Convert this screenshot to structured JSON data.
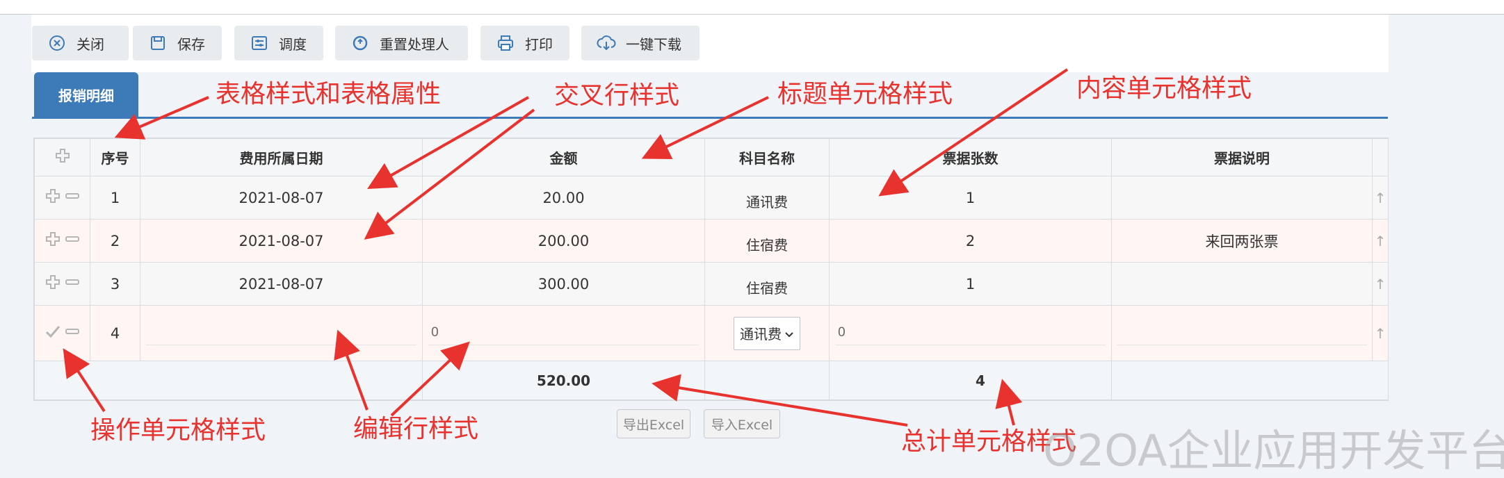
{
  "toolbar": {
    "buttons": [
      {
        "label": "关闭",
        "icon": "close-circle-icon"
      },
      {
        "label": "保存",
        "icon": "save-icon"
      },
      {
        "label": "调度",
        "icon": "dispatch-icon"
      },
      {
        "label": "重置处理人",
        "icon": "reset-icon"
      },
      {
        "label": "打印",
        "icon": "print-icon"
      },
      {
        "label": "一键下载",
        "icon": "cloud-download-icon"
      }
    ]
  },
  "tab": {
    "label": "报销明细"
  },
  "table": {
    "headers": [
      "序号",
      "费用所属日期",
      "金额",
      "科目名称",
      "票据张数",
      "票据说明"
    ],
    "rows": [
      {
        "index": "1",
        "date": "2021-08-07",
        "amount": "20.00",
        "subject": "通讯费",
        "count": "1",
        "note": ""
      },
      {
        "index": "2",
        "date": "2021-08-07",
        "amount": "200.00",
        "subject": "住宿费",
        "count": "2",
        "note": "来回两张票"
      },
      {
        "index": "3",
        "date": "2021-08-07",
        "amount": "300.00",
        "subject": "住宿费",
        "count": "1",
        "note": ""
      }
    ],
    "edit_row": {
      "index": "4",
      "date": "",
      "amount": "0",
      "subject": "通讯费",
      "count": "0",
      "note": ""
    },
    "total": {
      "amount": "520.00",
      "count": "4"
    }
  },
  "actions": {
    "export": "导出Excel",
    "import": "导入Excel"
  },
  "annotations": {
    "table_style": "表格样式和表格属性",
    "cross_row": "交叉行样式",
    "title_cell": "标题单元格样式",
    "content_cell": "内容单元格样式",
    "op_cell": "操作单元格样式",
    "edit_row": "编辑行样式",
    "total_cell": "总计单元格样式"
  },
  "watermark": "O2OA企业应用开发平台",
  "colors": {
    "accent": "#3d7ab8",
    "annotation": "#e8322d",
    "cross_row_bg": "#fff5f3"
  }
}
